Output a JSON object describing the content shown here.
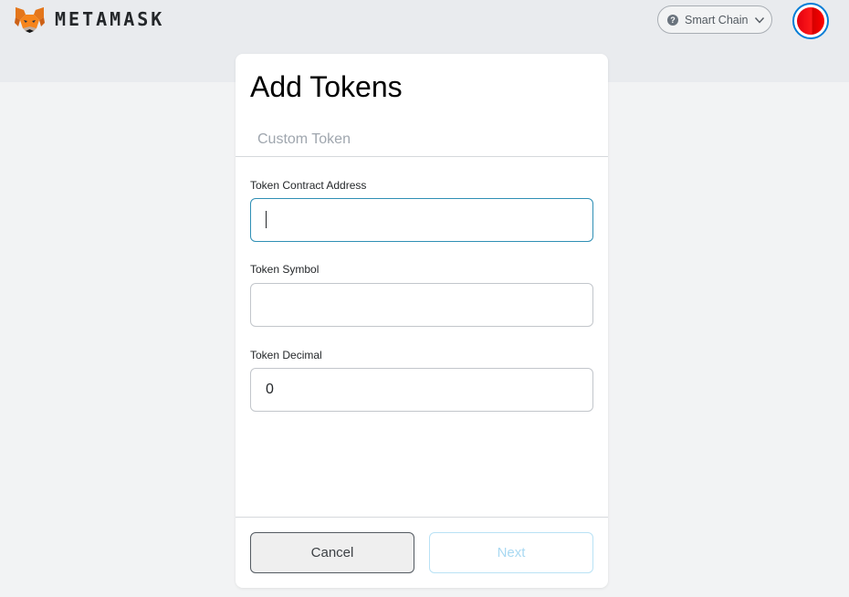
{
  "header": {
    "brand": "METAMASK",
    "network": {
      "name": "Smart Chain",
      "help_glyph": "?"
    },
    "avatar_colors": [
      "#ff0000",
      "#d40000"
    ]
  },
  "dialog": {
    "title": "Add Tokens",
    "tabs": [
      {
        "label": "Custom Token"
      }
    ],
    "fields": {
      "contract_address": {
        "label": "Token Contract Address",
        "value": ""
      },
      "symbol": {
        "label": "Token Symbol",
        "value": ""
      },
      "decimal": {
        "label": "Token Decimal",
        "value": "0"
      }
    },
    "buttons": {
      "cancel": "Cancel",
      "next": "Next"
    }
  },
  "colors": {
    "accent": "#037dd6",
    "focus_border": "#2f8fb5",
    "disabled_next": "#a9d9f2"
  },
  "icons": {
    "logo": "metamask-fox-icon",
    "network_help": "question-circle-icon",
    "network_dropdown": "chevron-down-icon"
  }
}
